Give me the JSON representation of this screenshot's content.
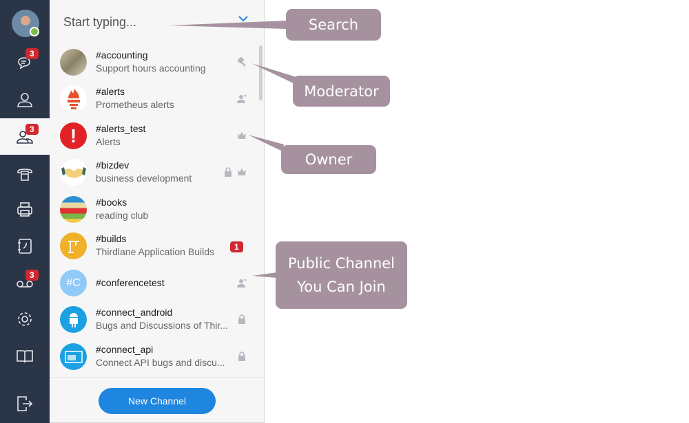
{
  "sidebar": {
    "items": [
      {
        "name": "chats",
        "icon": "chat-bubbles-icon",
        "badge": "3"
      },
      {
        "name": "contacts",
        "icon": "user-icon"
      },
      {
        "name": "channels",
        "icon": "group-icon",
        "badge": "3",
        "active": true
      },
      {
        "name": "phone",
        "icon": "phone-icon"
      },
      {
        "name": "fax",
        "icon": "printer-icon"
      },
      {
        "name": "address-book",
        "icon": "address-book-icon"
      },
      {
        "name": "voicemail",
        "icon": "voicemail-icon",
        "badge": "3"
      },
      {
        "name": "settings",
        "icon": "gear-icon"
      },
      {
        "name": "help",
        "icon": "book-icon"
      },
      {
        "name": "logout",
        "icon": "logout-icon"
      }
    ],
    "status_color": "#7ebd45"
  },
  "search": {
    "placeholder": "Start typing..."
  },
  "channels": [
    {
      "name": "#accounting",
      "desc": "Support hours accounting",
      "role": "moderator-gavel-icon"
    },
    {
      "name": "#alerts",
      "desc": "Prometheus alerts",
      "role": "join-user-plus-icon"
    },
    {
      "name": "#alerts_test",
      "desc": "Alerts",
      "role": "owner-crown-icon"
    },
    {
      "name": "#bizdev",
      "desc": "business development",
      "role": "lock-and-crown-icon"
    },
    {
      "name": "#books",
      "desc": "reading club"
    },
    {
      "name": "#builds",
      "desc": "Thirdlane Application Builds",
      "badge": "1"
    },
    {
      "name": "#conferencetest",
      "avatar_text": "#C",
      "role": "join-user-plus-icon"
    },
    {
      "name": "#connect_android",
      "desc": "Bugs and Discussions of Thir...",
      "role": "lock-icon"
    },
    {
      "name": "#connect_api",
      "desc": "Connect API bugs and discu...",
      "role": "lock-icon"
    }
  ],
  "footer": {
    "new_channel": "New Channel"
  },
  "callouts": {
    "search": "Search",
    "moderator": "Moderator",
    "owner": "Owner",
    "public1": "Public Channel",
    "public2": "You Can Join"
  },
  "colors": {
    "sidebar": "#2b3548",
    "accent": "#1f86e0",
    "badge": "#d0282f",
    "callout": "#a6929f"
  }
}
